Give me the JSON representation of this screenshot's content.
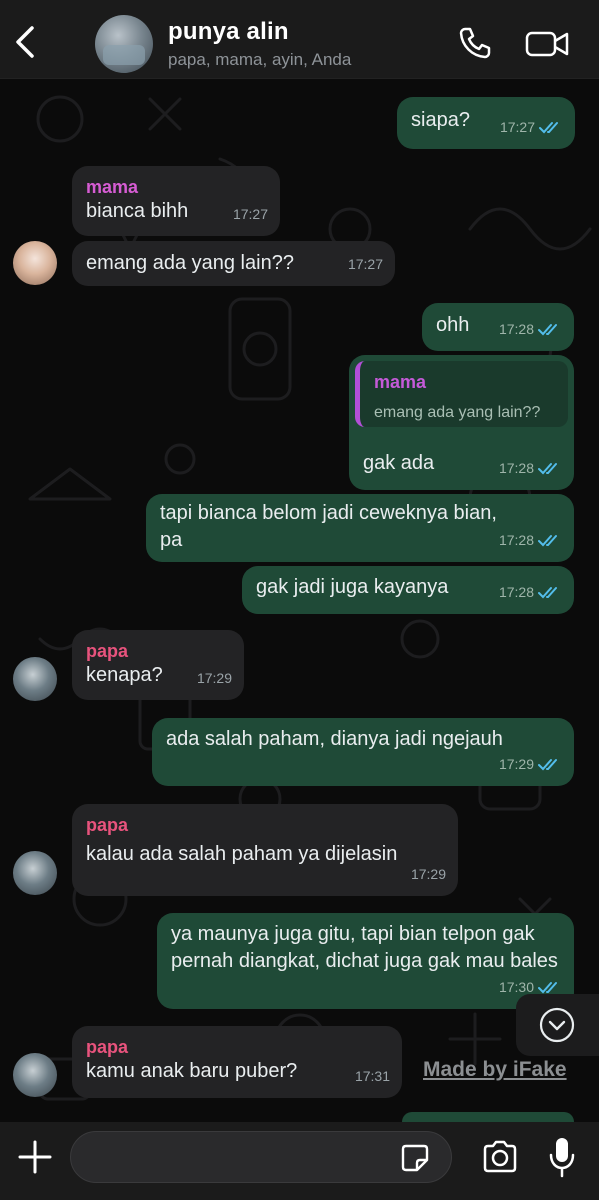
{
  "header": {
    "title": "punya alin",
    "participants": "papa, mama, ayin, Anda"
  },
  "messages": [
    {
      "dir": "out",
      "text": "siapa?",
      "time": "17:27"
    },
    {
      "dir": "in",
      "sender": "mama",
      "text": "bianca bihh",
      "time": "17:27"
    },
    {
      "dir": "in",
      "text": "emang ada yang lain??",
      "time": "17:27"
    },
    {
      "dir": "out",
      "text": "ohh",
      "time": "17:28"
    },
    {
      "dir": "out",
      "quote": {
        "name": "mama",
        "text": "emang ada yang lain??"
      },
      "text": "gak ada",
      "time": "17:28"
    },
    {
      "dir": "out",
      "text": "tapi bianca belom jadi ceweknya bian, pa",
      "time": "17:28"
    },
    {
      "dir": "out",
      "text": "gak jadi juga kayanya",
      "time": "17:28"
    },
    {
      "dir": "in",
      "sender": "papa",
      "text": "kenapa?",
      "time": "17:29"
    },
    {
      "dir": "out",
      "text": "ada salah paham, dianya jadi ngejauh",
      "time": "17:29"
    },
    {
      "dir": "in",
      "sender": "papa",
      "text": "kalau ada salah paham ya dijelasin",
      "time": "17:29"
    },
    {
      "dir": "out",
      "text": "ya maunya juga gitu, tapi bian telpon gak pernah diangkat, dichat juga gak mau bales",
      "time": "17:30"
    },
    {
      "dir": "in",
      "sender": "papa",
      "text": "kamu anak baru puber?",
      "time": "17:31"
    }
  ],
  "watermark": "Made by iFake",
  "composer": {
    "placeholder": ""
  },
  "colors": {
    "outgoing_bubble": "#1f4a37",
    "incoming_bubble": "#232325",
    "mama_name": "#d65cd3",
    "papa_name": "#e8537d",
    "read_ticks": "#53bdeb"
  },
  "icons": [
    "back-chevron-icon",
    "phone-icon",
    "video-camera-icon",
    "double-check-icon",
    "chevron-down-icon",
    "plus-icon",
    "sticker-icon",
    "camera-icon",
    "microphone-icon"
  ]
}
